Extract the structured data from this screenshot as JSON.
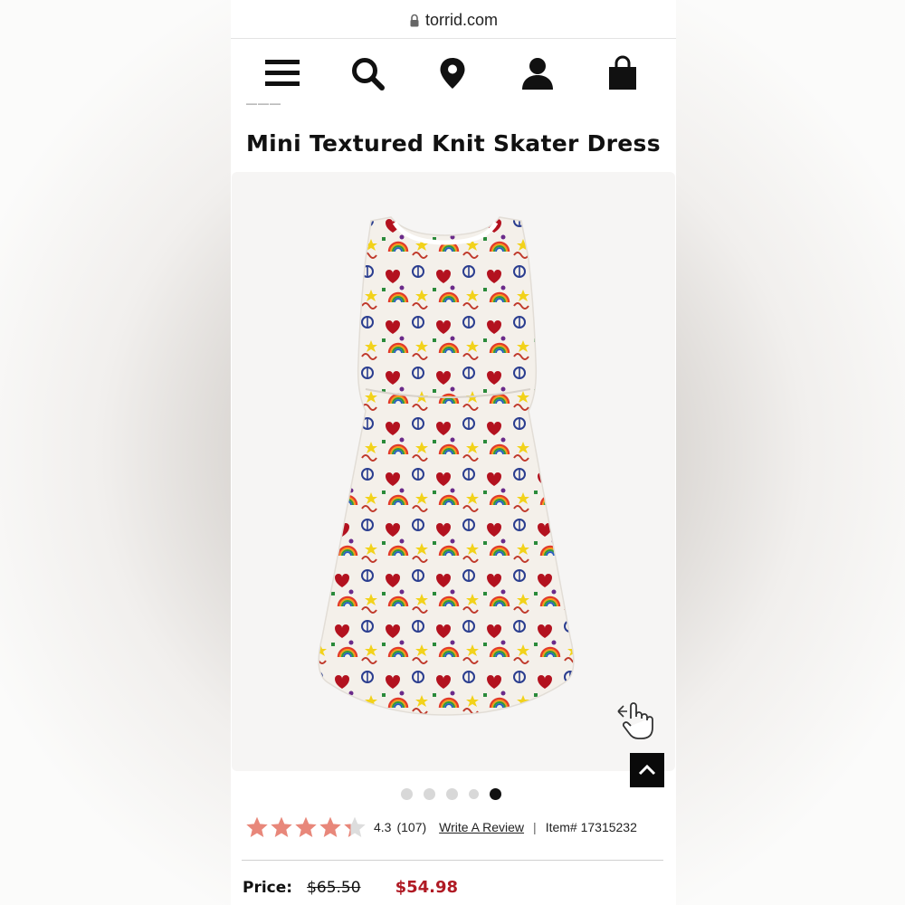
{
  "browser": {
    "url": "torrid.com",
    "lock_icon": "lock-icon"
  },
  "nav": {
    "icons": [
      "menu-icon",
      "search-icon",
      "location-pin-icon",
      "account-icon",
      "shopping-bag-icon"
    ]
  },
  "product": {
    "title": "Mini Textured Knit Skater Dress",
    "image_count": 5,
    "active_image_index": 4,
    "rating": "4.3",
    "rating_value": 4.3,
    "rating_max": 5,
    "review_count": "(107)",
    "write_review_label": "Write A Review",
    "separator": "|",
    "item_number": "Item# 17315232",
    "price_label": "Price:",
    "original_price": "$65.50",
    "sale_price": "$54.98"
  },
  "colors": {
    "star_fill": "#e8877a",
    "star_empty": "#dddddd",
    "sale_price": "#b01a24",
    "back_to_top_bg": "#0a0a0a"
  }
}
